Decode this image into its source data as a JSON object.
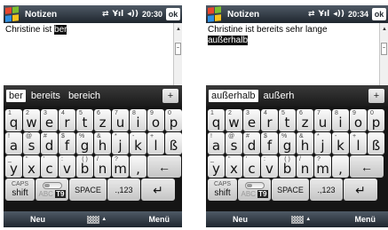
{
  "colors": {
    "titlebar_top": "#4f5a66",
    "titlebar_bottom": "#1f262e",
    "keyboard_bg": "#151515",
    "key_face": "#fbfbfb",
    "text_highlight": "#0d0d0d",
    "windows_logo": [
      "#e8452c",
      "#7dbf2f",
      "#2f8fe0",
      "#f7c21d"
    ]
  },
  "screens": [
    {
      "titlebar": {
        "title": "Notizen",
        "icons": [
          "signal-sync-icon",
          "antenna-icon",
          "speaker-icon"
        ],
        "clock": "20:30",
        "ok_label": "ok"
      },
      "note": {
        "lines": [
          {
            "text": "Christine ist ",
            "highlight": "ber"
          }
        ]
      },
      "suggestions": {
        "items": [
          "ber",
          "bereits",
          "bereich"
        ],
        "selected_index": 0,
        "add_label": "+"
      },
      "softkeys": {
        "left": "Neu",
        "right": "Menü"
      }
    },
    {
      "titlebar": {
        "title": "Notizen",
        "icons": [
          "signal-sync-icon",
          "antenna-icon",
          "speaker-icon"
        ],
        "clock": "20:34",
        "ok_label": "ok"
      },
      "note": {
        "lines": [
          {
            "text": "Christine ist bereits sehr lange",
            "highlight": ""
          },
          {
            "text": "",
            "highlight": "außerhalb"
          }
        ]
      },
      "suggestions": {
        "items": [
          "außerhalb",
          "außerh"
        ],
        "selected_index": 0,
        "add_label": "+"
      },
      "softkeys": {
        "left": "Neu",
        "right": "Menü"
      }
    }
  ],
  "keyboard": {
    "row1": [
      {
        "main": "q",
        "sub": "1"
      },
      {
        "main": "w",
        "sub": "2"
      },
      {
        "main": "e",
        "sub": "3"
      },
      {
        "main": "r",
        "sub": "4"
      },
      {
        "main": "t",
        "sub": "5"
      },
      {
        "main": "z",
        "sub": "6"
      },
      {
        "main": "u",
        "sub": "7"
      },
      {
        "main": "i",
        "sub": "8"
      },
      {
        "main": "o",
        "sub": "9"
      },
      {
        "main": "p",
        "sub": "0"
      }
    ],
    "row2": [
      {
        "main": "a",
        "sub": "!"
      },
      {
        "main": "s",
        "sub": "@"
      },
      {
        "main": "d",
        "sub": "#"
      },
      {
        "main": "f",
        "sub": "$"
      },
      {
        "main": "g",
        "sub": "%"
      },
      {
        "main": "h",
        "sub": "&"
      },
      {
        "main": "j",
        "sub": "*"
      },
      {
        "main": "k",
        "sub": "-"
      },
      {
        "main": "l",
        "sub": "+"
      },
      {
        "main": "ß",
        "sub": ""
      }
    ],
    "row3": [
      {
        "main": "y",
        "sub": "_"
      },
      {
        "main": "x",
        "sub": "\""
      },
      {
        "main": "c",
        "sub": "'"
      },
      {
        "main": "v",
        "sub": ":"
      },
      {
        "main": "b",
        "sub": "( )"
      },
      {
        "main": "n",
        "sub": "/"
      },
      {
        "main": "m",
        "sub": "?"
      },
      {
        "main": ",",
        "sub": ""
      }
    ],
    "backspace_icon": "backspace-arrow-icon",
    "shift": {
      "caps": "CAPS",
      "label": "shift"
    },
    "t9": {
      "abc": "ABC",
      "t9": "T9"
    },
    "space_label": "SPACE",
    "symbols_label": ".,123",
    "enter_icon": "enter-icon"
  }
}
